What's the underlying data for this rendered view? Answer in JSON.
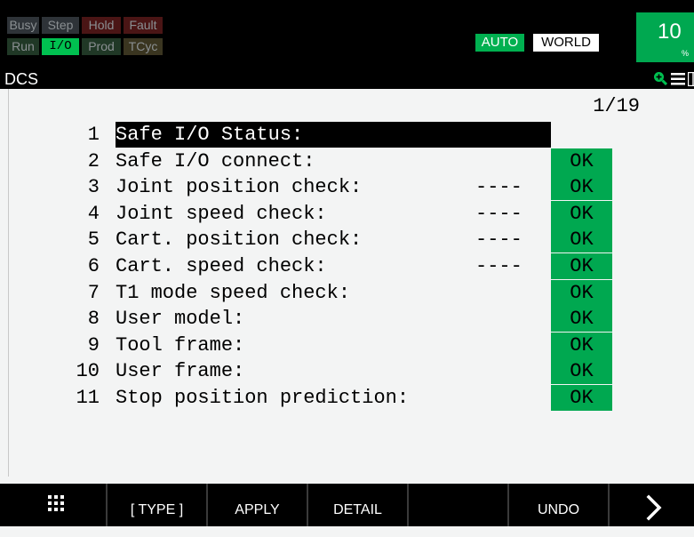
{
  "status": {
    "row1": [
      {
        "label": "Busy",
        "state": "off"
      },
      {
        "label": "Step",
        "state": "off"
      },
      {
        "label": "Hold",
        "state": "off"
      },
      {
        "label": "Fault",
        "state": "off"
      }
    ],
    "row2": [
      {
        "label": "Run",
        "state": "off"
      },
      {
        "label": "I/O",
        "state": "on"
      },
      {
        "label": "Prod",
        "state": "off"
      },
      {
        "label": "TCyc",
        "state": "off"
      }
    ],
    "mode": "AUTO",
    "coord": "WORLD",
    "speed_value": "10",
    "speed_unit": "%"
  },
  "title": "DCS",
  "title_icons": [
    "zoom-icon",
    "menu-icon",
    "split-view-icon"
  ],
  "page_indicator": "1/19",
  "rows": [
    {
      "num": "1",
      "label": "Safe I/O Status:",
      "dash": "",
      "status": "",
      "selected": true
    },
    {
      "num": "2",
      "label": "Safe I/O connect:",
      "dash": "",
      "status": "OK"
    },
    {
      "num": "3",
      "label": "Joint position check:",
      "dash": "----",
      "status": "OK"
    },
    {
      "num": "4",
      "label": "Joint speed check:",
      "dash": "----",
      "status": "OK"
    },
    {
      "num": "5",
      "label": "Cart. position check:",
      "dash": "----",
      "status": "OK"
    },
    {
      "num": "6",
      "label": "Cart. speed check:",
      "dash": "----",
      "status": "OK"
    },
    {
      "num": "7",
      "label": "T1 mode speed check:",
      "dash": "",
      "status": "OK"
    },
    {
      "num": "8",
      "label": "User model:",
      "dash": "",
      "status": "OK"
    },
    {
      "num": "9",
      "label": "Tool frame:",
      "dash": "",
      "status": "OK"
    },
    {
      "num": "10",
      "label": "User frame:",
      "dash": "",
      "status": "OK"
    },
    {
      "num": "11",
      "label": "Stop position prediction:",
      "dash": "",
      "status": "OK"
    }
  ],
  "function_keys": {
    "menu_icon": "grid-icon",
    "f1": "[ TYPE ]",
    "f2": "APPLY",
    "f3": "DETAIL",
    "f4": "",
    "f5": "UNDO",
    "next_icon": "chevron-right-icon"
  },
  "colors": {
    "accent_green": "#00a850",
    "status_on": "#00b050",
    "status_off_row1": "#2e3338",
    "background": "#f3f4f4"
  }
}
